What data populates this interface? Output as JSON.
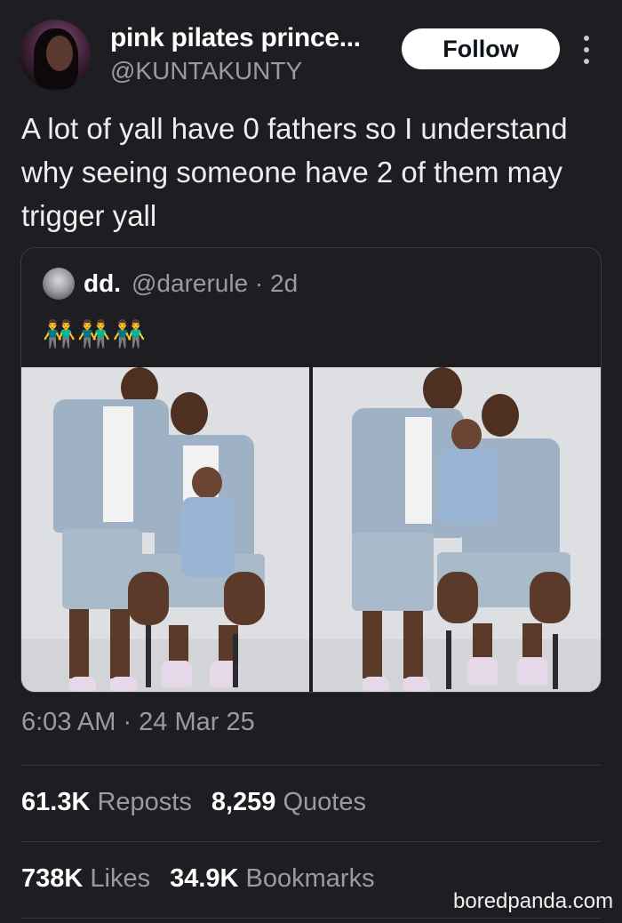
{
  "header": {
    "display_name": "pink pilates prince...",
    "handle": "@KUNTAKUNTY",
    "follow_label": "Follow"
  },
  "tweet": {
    "text": "A lot of yall have 0 fathers so I understand why seeing someone have 2 of them may trigger yall"
  },
  "quote": {
    "name": "dd.",
    "handle_time": "@darerule · 2d",
    "emojis": "👬👬👬"
  },
  "meta": {
    "timestamp": "6:03 AM · 24 Mar 25"
  },
  "stats": {
    "reposts_count": "61.3K",
    "reposts_label": "Reposts",
    "quotes_count": "8,259",
    "quotes_label": "Quotes",
    "likes_count": "738K",
    "likes_label": "Likes",
    "bookmarks_count": "34.9K",
    "bookmarks_label": "Bookmarks"
  },
  "watermark": "boredpanda.com",
  "icons": [
    "more-vertical-icon"
  ],
  "colors": {
    "background": "#1e1d22",
    "text": "#e7e9ea",
    "muted": "#9a9ba0",
    "follow_bg": "#ffffff"
  }
}
